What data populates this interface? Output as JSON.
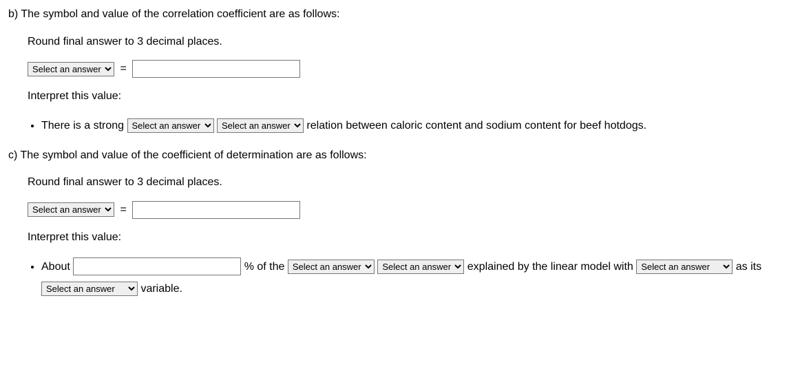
{
  "partB": {
    "header": "b) The symbol and value of the correlation coefficient are as follows:",
    "instruction": "Round final answer to 3 decimal places.",
    "selectPlaceholder": "Select an answer",
    "equals": "=",
    "interpretLabel": "Interpret this value:",
    "bullet": {
      "preText": "There is a strong ",
      "select1": "Select an answer",
      "select2": "Select an answer",
      "midText": " relation between caloric content and sodium content for beef hotdogs."
    }
  },
  "partC": {
    "header": "c) The symbol and value of the coefficient of determination are as follows:",
    "instruction": "Round final answer to 3 decimal places.",
    "selectPlaceholder": "Select an answer",
    "equals": "=",
    "interpretLabel": "Interpret this value:",
    "bullet": {
      "aboutText": "About ",
      "pctText": " % of the ",
      "select1": "Select an answer",
      "select2": "Select an answer",
      "explainedText": " explained by the linear model with ",
      "select3": "Select an answer",
      "asItsText": " as its ",
      "select4": "Select an answer",
      "varText": " variable."
    }
  }
}
